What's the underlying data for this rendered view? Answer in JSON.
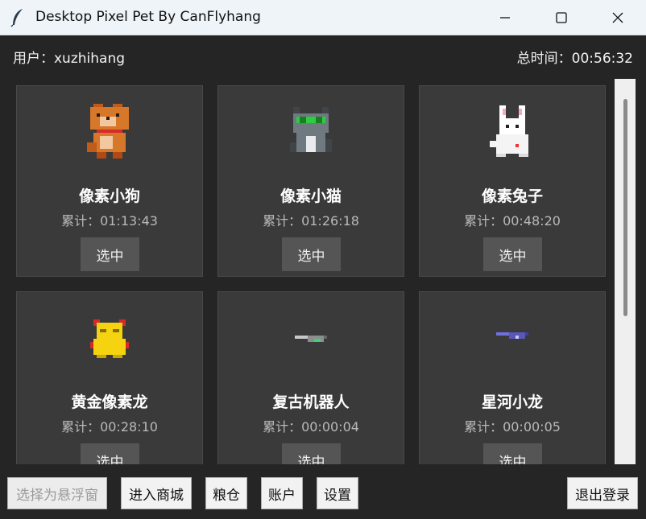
{
  "window": {
    "title": "Desktop Pixel Pet By CanFlyhang"
  },
  "header": {
    "user_label": "用户：xuzhihang",
    "total_time_label": "总时间：00:56:32"
  },
  "pets": [
    {
      "name": "像素小狗",
      "time": "累计：01:13:43",
      "button": "选中",
      "sprite": "dog-icon"
    },
    {
      "name": "像素小猫",
      "time": "累计：01:26:18",
      "button": "选中",
      "sprite": "cat-icon"
    },
    {
      "name": "像素兔子",
      "time": "累计：00:48:20",
      "button": "选中",
      "sprite": "rabbit-icon"
    },
    {
      "name": "黄金像素龙",
      "time": "累计：00:28:10",
      "button": "选中",
      "sprite": "golden-dragon-icon"
    },
    {
      "name": "复古机器人",
      "time": "累计：00:00:04",
      "button": "选中",
      "sprite": "retro-robot-icon"
    },
    {
      "name": "星河小龙",
      "time": "累计：00:00:05",
      "button": "选中",
      "sprite": "galaxy-dragon-icon"
    }
  ],
  "footer": {
    "float_window": "选择为悬浮窗",
    "shop": "进入商城",
    "granary": "粮仓",
    "account": "账户",
    "settings": "设置",
    "logout": "退出登录"
  },
  "colors": {
    "background": "#252525",
    "card": "#3a3a3a",
    "card_button": "#555555",
    "titlebar": "#eef4f8"
  }
}
